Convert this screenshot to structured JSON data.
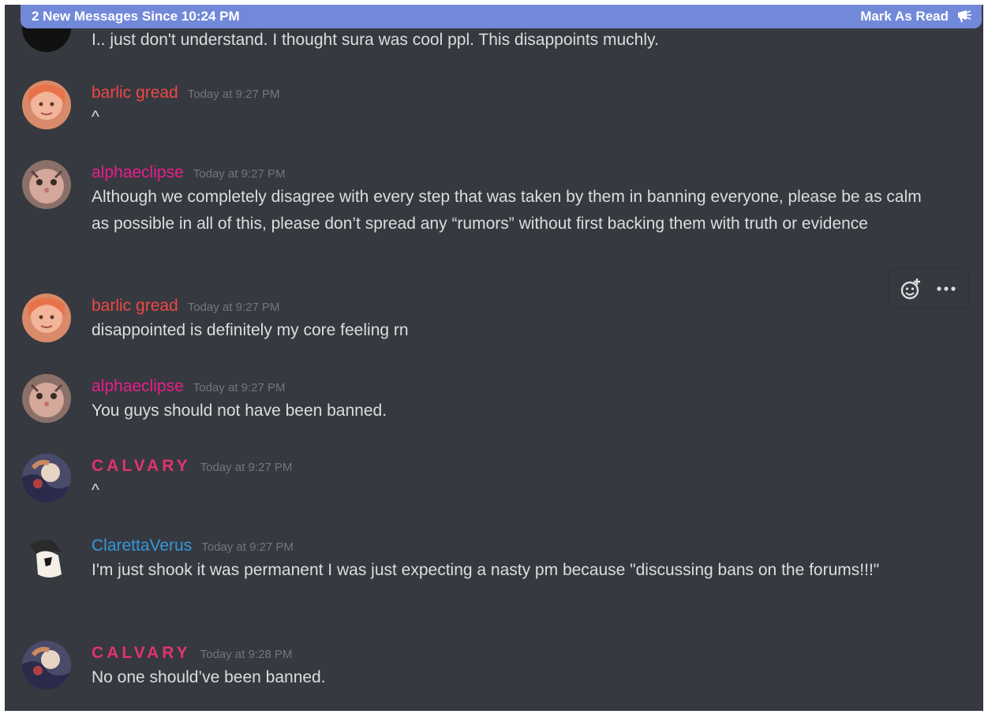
{
  "banner": {
    "text": "2 New Messages Since 10:24 PM",
    "action_label": "Mark As Read"
  },
  "colors": {
    "background": "#36393f",
    "banner": "#7289da",
    "text": "#dcddde",
    "timestamp": "#72767d",
    "name_barlic": "#f04747",
    "name_alpha": "#e91e8c",
    "name_calvary": "#e2336e",
    "name_claretta": "#3498db"
  },
  "partial_message": {
    "content": "I.. just don't understand. I thought sura was cool ppl. This disappoints muchly."
  },
  "messages": [
    {
      "author": "barlic gread",
      "timestamp": "Today at 9:27 PM",
      "content": "^"
    },
    {
      "author": "alphaeclipse",
      "timestamp": "Today at 9:27 PM",
      "content": "Although we completely disagree with every step that was taken by them in banning everyone, please be as calm as possible in all of this, please don’t spread any “rumors” without first backing them with truth or evidence"
    },
    {
      "author": "barlic gread",
      "timestamp": "Today at 9:27 PM",
      "content": "disappointed is definitely my core feeling rn"
    },
    {
      "author": "alphaeclipse",
      "timestamp": "Today at 9:27 PM",
      "content": "You guys should not have been banned."
    },
    {
      "author": "CALVARY",
      "timestamp": "Today at 9:27 PM",
      "content": "^"
    },
    {
      "author": "ClarettaVerus",
      "timestamp": "Today at 9:27 PM",
      "content": "I'm just shook it was permanent I was just expecting a nasty pm because \"discussing bans on the forums!!!\""
    },
    {
      "author": "CALVARY",
      "timestamp": "Today at 9:28 PM",
      "content": "No one should’ve been banned."
    }
  ],
  "hover_actions": [
    {
      "icon": "add-reaction-icon"
    },
    {
      "icon": "more-options-icon"
    }
  ]
}
